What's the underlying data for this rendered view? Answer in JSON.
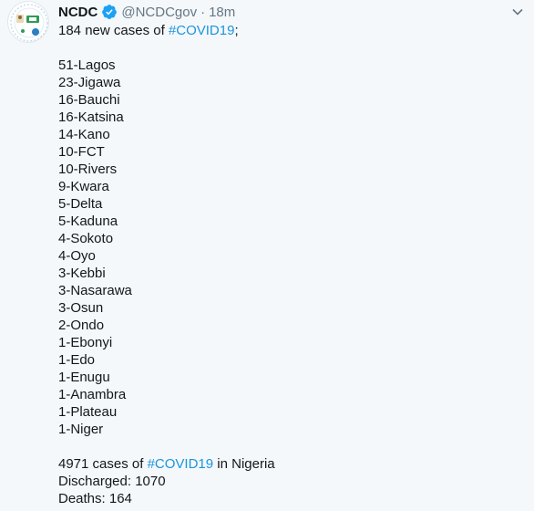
{
  "account": {
    "name": "NCDC",
    "handle": "@NCDCgov",
    "separator": "·",
    "time": "18m"
  },
  "icons": {
    "verified": "verified-badge-icon",
    "caret": "chevron-down-icon"
  },
  "colors": {
    "hashtag": "#1b95e0",
    "verified": "#1da1f2",
    "secondary_text": "#657786",
    "background": "#f5f8fa"
  },
  "tweet": {
    "intro": {
      "prefix": "184 new cases of ",
      "hashtag": "#COVID19",
      "suffix": ";"
    },
    "states": [
      "51-Lagos",
      "23-Jigawa",
      "16-Bauchi",
      "16-Katsina",
      "14-Kano",
      "10-FCT",
      "10-Rivers",
      "9-Kwara",
      "5-Delta",
      "5-Kaduna",
      "4-Sokoto",
      "4-Oyo",
      "3-Kebbi",
      "3-Nasarawa",
      "3-Osun",
      "2-Ondo",
      "1-Ebonyi",
      "1-Edo",
      "1-Enugu",
      "1-Anambra",
      "1-Plateau",
      "1-Niger"
    ],
    "summary": {
      "prefix": "4971 cases of ",
      "hashtag": "#COVID19",
      "suffix": " in Nigeria"
    },
    "discharged": "Discharged: 1070",
    "deaths": "Deaths: 164"
  }
}
